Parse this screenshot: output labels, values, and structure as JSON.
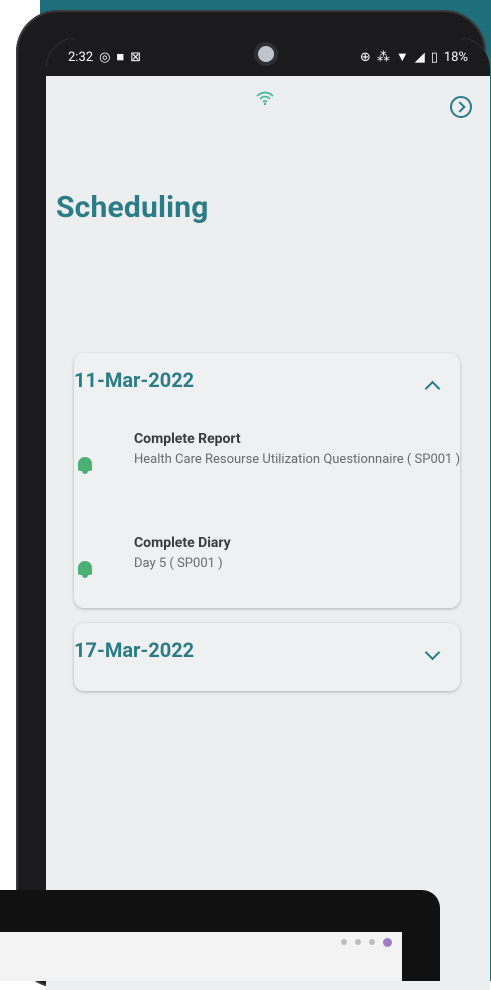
{
  "status_bar": {
    "time": "2:32",
    "battery": "18%"
  },
  "page": {
    "title": "Scheduling"
  },
  "schedule": [
    {
      "date": "11-Mar-2022",
      "expanded": true,
      "items": [
        {
          "title": "Complete Report",
          "description": "Health Care Resourse Utilization Questionnaire ( SP001 )"
        },
        {
          "title": "Complete Diary",
          "description": "Day 5 ( SP001 )"
        }
      ]
    },
    {
      "date": "17-Mar-2022",
      "expanded": false,
      "items": []
    }
  ],
  "colors": {
    "accent": "#2a7c86",
    "bell": "#4caf73",
    "background": "#eceeef"
  }
}
